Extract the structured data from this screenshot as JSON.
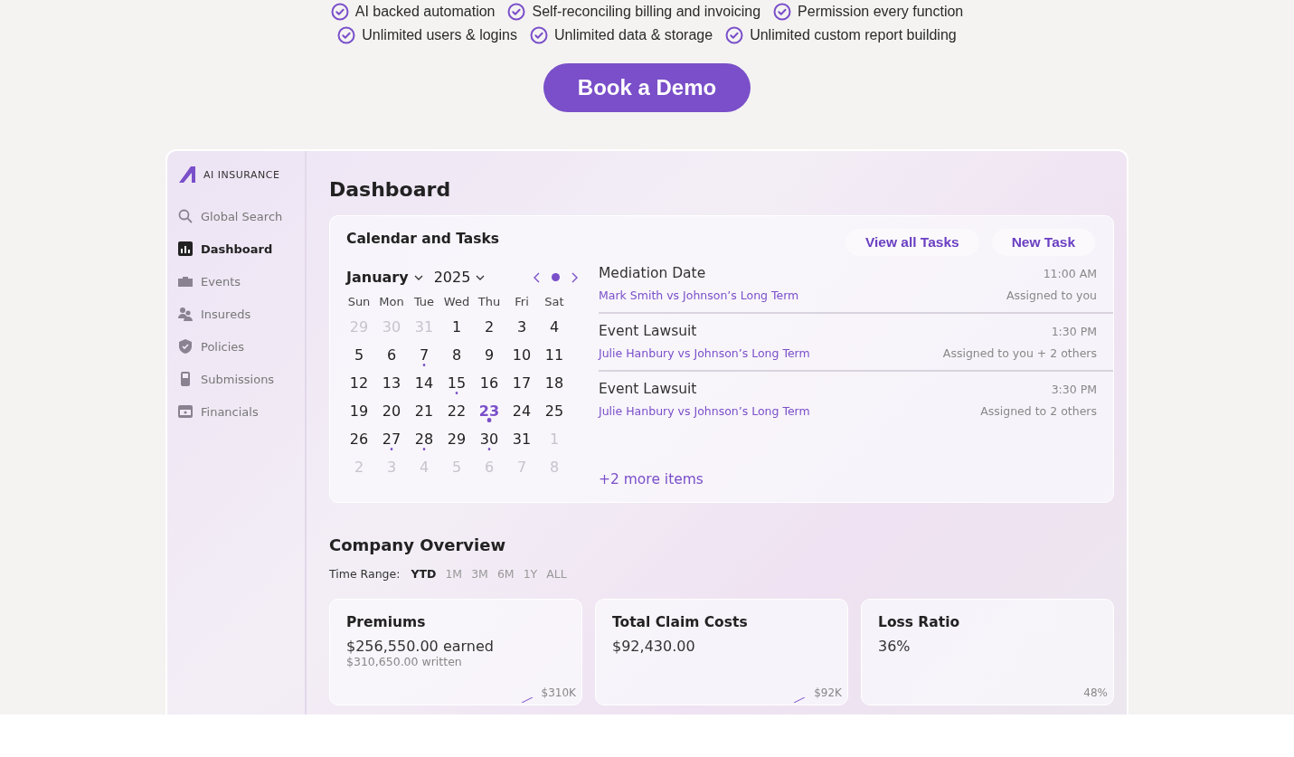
{
  "features": [
    {
      "label": "AI backed automation"
    },
    {
      "label": "Self-reconciling billing and invoicing"
    },
    {
      "label": "Permission every function"
    },
    {
      "label": "Unlimited users & logins"
    },
    {
      "label": "Unlimited data & storage"
    },
    {
      "label": "Unlimited custom report building"
    }
  ],
  "cta": {
    "label": "Book a Demo"
  },
  "app": {
    "logo": "AI INSURANCE",
    "sidebar": {
      "items": [
        {
          "label": "Global Search",
          "selected": false
        },
        {
          "label": "Dashboard",
          "selected": true
        },
        {
          "label": "Events",
          "selected": false
        },
        {
          "label": "Insureds",
          "selected": false
        },
        {
          "label": "Policies",
          "selected": false
        },
        {
          "label": "Submissions",
          "selected": false
        },
        {
          "label": "Financials",
          "selected": false
        }
      ]
    },
    "title": "Dashboard",
    "calendar_card": {
      "title": "Calendar and Tasks",
      "buttons": [
        "View all Tasks",
        "New Task"
      ],
      "month": "January",
      "year": "2025",
      "weekdays": [
        "Sun",
        "Mon",
        "Tue",
        "Wed",
        "Thu",
        "Fri",
        "Sat"
      ],
      "weeks": [
        [
          {
            "day": "29",
            "muted": true,
            "dot": false,
            "selected": false
          },
          {
            "day": "30",
            "muted": true,
            "dot": false,
            "selected": false
          },
          {
            "day": "31",
            "muted": true,
            "dot": false,
            "selected": false
          },
          {
            "day": "1",
            "muted": false,
            "dot": false,
            "selected": false
          },
          {
            "day": "2",
            "muted": false,
            "dot": false,
            "selected": false
          },
          {
            "day": "3",
            "muted": false,
            "dot": false,
            "selected": false
          },
          {
            "day": "4",
            "muted": false,
            "dot": false,
            "selected": false
          }
        ],
        [
          {
            "day": "5",
            "muted": false,
            "dot": false,
            "selected": false
          },
          {
            "day": "6",
            "muted": false,
            "dot": false,
            "selected": false
          },
          {
            "day": "7",
            "muted": false,
            "dot": true,
            "selected": false
          },
          {
            "day": "8",
            "muted": false,
            "dot": false,
            "selected": false
          },
          {
            "day": "9",
            "muted": false,
            "dot": false,
            "selected": false
          },
          {
            "day": "10",
            "muted": false,
            "dot": false,
            "selected": false
          },
          {
            "day": "11",
            "muted": false,
            "dot": false,
            "selected": false
          }
        ],
        [
          {
            "day": "12",
            "muted": false,
            "dot": false,
            "selected": false
          },
          {
            "day": "13",
            "muted": false,
            "dot": false,
            "selected": false
          },
          {
            "day": "14",
            "muted": false,
            "dot": false,
            "selected": false
          },
          {
            "day": "15",
            "muted": false,
            "dot": true,
            "selected": false
          },
          {
            "day": "16",
            "muted": false,
            "dot": false,
            "selected": false
          },
          {
            "day": "17",
            "muted": false,
            "dot": false,
            "selected": false
          },
          {
            "day": "18",
            "muted": false,
            "dot": false,
            "selected": false
          }
        ],
        [
          {
            "day": "19",
            "muted": false,
            "dot": false,
            "selected": false
          },
          {
            "day": "20",
            "muted": false,
            "dot": false,
            "selected": false
          },
          {
            "day": "21",
            "muted": false,
            "dot": false,
            "selected": false
          },
          {
            "day": "22",
            "muted": false,
            "dot": false,
            "selected": false
          },
          {
            "day": "23",
            "muted": false,
            "dot": true,
            "selected": true
          },
          {
            "day": "24",
            "muted": false,
            "dot": false,
            "selected": false
          },
          {
            "day": "25",
            "muted": false,
            "dot": false,
            "selected": false
          }
        ],
        [
          {
            "day": "26",
            "muted": false,
            "dot": false,
            "selected": false
          },
          {
            "day": "27",
            "muted": false,
            "dot": true,
            "selected": false
          },
          {
            "day": "28",
            "muted": false,
            "dot": true,
            "selected": false
          },
          {
            "day": "29",
            "muted": false,
            "dot": false,
            "selected": false
          },
          {
            "day": "30",
            "muted": false,
            "dot": true,
            "selected": false
          },
          {
            "day": "31",
            "muted": false,
            "dot": false,
            "selected": false
          },
          {
            "day": "1",
            "muted": true,
            "dot": false,
            "selected": false
          }
        ],
        [
          {
            "day": "2",
            "muted": true,
            "dot": false,
            "selected": false
          },
          {
            "day": "3",
            "muted": true,
            "dot": false,
            "selected": false
          },
          {
            "day": "4",
            "muted": true,
            "dot": false,
            "selected": false
          },
          {
            "day": "5",
            "muted": true,
            "dot": false,
            "selected": false
          },
          {
            "day": "6",
            "muted": true,
            "dot": false,
            "selected": false
          },
          {
            "day": "7",
            "muted": true,
            "dot": false,
            "selected": false
          },
          {
            "day": "8",
            "muted": true,
            "dot": false,
            "selected": false
          }
        ]
      ],
      "tasks": [
        {
          "title": "Mediation Date",
          "time": "11:00 AM",
          "case": "Mark Smith vs Johnson’s Long Term",
          "assigned": "Assigned to you"
        },
        {
          "title": "Event Lawsuit",
          "time": "1:30 PM",
          "case": "Julie Hanbury vs Johnson’s Long Term",
          "assigned": "Assigned to you + 2 others"
        },
        {
          "title": "Event Lawsuit",
          "time": "3:30 PM",
          "case": "Julie Hanbury vs Johnson’s Long Term",
          "assigned": "Assigned to 2 others"
        }
      ],
      "more": "+2 more items"
    },
    "overview": {
      "title": "Company Overview",
      "range_label": "Time Range:",
      "ranges": [
        {
          "label": "YTD",
          "selected": true
        },
        {
          "label": "1M",
          "selected": false
        },
        {
          "label": "3M",
          "selected": false
        },
        {
          "label": "6M",
          "selected": false
        },
        {
          "label": "1Y",
          "selected": false
        },
        {
          "label": "ALL",
          "selected": false
        }
      ],
      "cards": [
        {
          "title": "Premiums",
          "value": "$256,550.00 earned",
          "sub": "$310,650.00 written",
          "peak": "$310K"
        },
        {
          "title": "Total Claim Costs",
          "value": "$92,430.00",
          "peak": "$92K"
        },
        {
          "title": "Loss Ratio",
          "value": "36%",
          "peak": "48%"
        }
      ]
    }
  }
}
